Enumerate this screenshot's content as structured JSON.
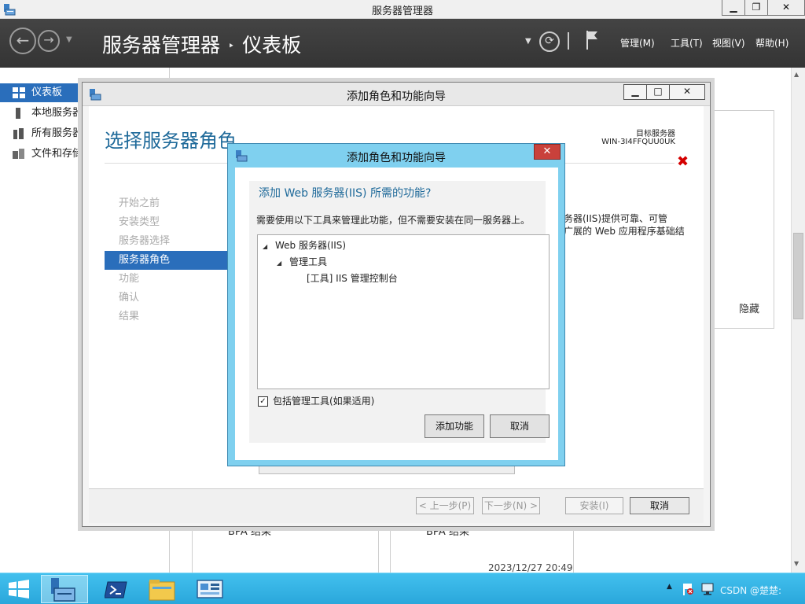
{
  "window": {
    "title": "服务器管理器",
    "min_label": "▁",
    "restore_label": "❐",
    "close_label": "✕"
  },
  "header": {
    "app": "服务器管理器",
    "page": "仪表板",
    "crumb_sep": "‣",
    "menu": [
      {
        "label": "管理(M)"
      },
      {
        "label": "工具(T)"
      },
      {
        "label": "视图(V)"
      },
      {
        "label": "帮助(H)"
      }
    ]
  },
  "sidebar": {
    "items": [
      {
        "label": "仪表板",
        "active": true
      },
      {
        "label": "本地服务器",
        "active": false
      },
      {
        "label": "所有服务器",
        "active": false
      },
      {
        "label": "文件和存储服务",
        "active": false
      }
    ]
  },
  "background": {
    "hide_label": "隐藏",
    "bpa_left": "BPA 结果",
    "bpa_right": "BPA 结果",
    "timestamp": "2023/12/27 20:49"
  },
  "wizard": {
    "title": "添加角色和功能向导",
    "heading": "选择服务器角色",
    "target_label": "目标服务器",
    "target_value": "WIN-3I4FFQUU0UK",
    "steps": [
      {
        "label": "开始之前",
        "active": false
      },
      {
        "label": "安装类型",
        "active": false
      },
      {
        "label": "服务器选择",
        "active": false
      },
      {
        "label": "服务器角色",
        "active": true
      },
      {
        "label": "功能",
        "active": false
      },
      {
        "label": "确认",
        "active": false
      },
      {
        "label": "结果",
        "active": false
      }
    ],
    "desc_line1": "务器(IIS)提供可靠、可管",
    "desc_line2": "广展的 Web 应用程序基础结",
    "footer": {
      "prev": "< 上一步(P)",
      "next": "下一步(N) >",
      "install": "安装(I)",
      "cancel": "取消"
    }
  },
  "dialog": {
    "title": "添加角色和功能向导",
    "heading": "添加 Web 服务器(IIS) 所需的功能?",
    "description": "需要使用以下工具来管理此功能，但不需要安装在同一服务器上。",
    "tree": [
      {
        "label": "Web 服务器(IIS)",
        "level": 0,
        "expander": "◢"
      },
      {
        "label": "管理工具",
        "level": 1,
        "expander": "◢"
      },
      {
        "label": "[工具] IIS 管理控制台",
        "level": 2,
        "expander": ""
      }
    ],
    "include_tools_label": "包括管理工具(如果适用)",
    "include_tools_checked": true,
    "check_mark": "✓",
    "add_button": "添加功能",
    "cancel_button": "取消"
  },
  "taskbar": {
    "watermark": "CSDN @楚楚:"
  },
  "colors": {
    "accent": "#2a6ebb",
    "header_bg": "#3a3a3a",
    "dialog_frame": "#7fd0ef",
    "taskbar": "#35b6e8",
    "heading": "#1f6a9a",
    "error_x": "#d40000"
  }
}
